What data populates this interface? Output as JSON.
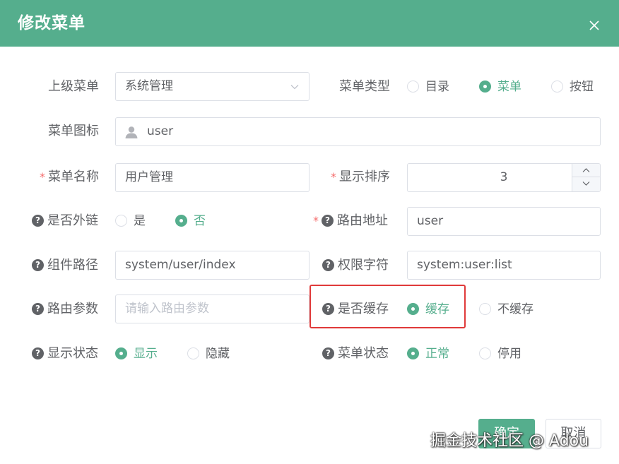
{
  "dialog": {
    "title": "修改菜单",
    "close_icon": "close-icon"
  },
  "form": {
    "parent_menu": {
      "label": "上级菜单",
      "value": "系统管理"
    },
    "menu_type": {
      "label": "菜单类型",
      "options": [
        "目录",
        "菜单",
        "按钮"
      ],
      "selected": "菜单"
    },
    "menu_icon": {
      "label": "菜单图标",
      "icon": "user-icon",
      "value": "user"
    },
    "menu_name": {
      "required_mark": "*",
      "label": "菜单名称",
      "value": "用户管理"
    },
    "order": {
      "required_mark": "*",
      "label": "显示排序",
      "value": "3"
    },
    "is_external": {
      "help": "?",
      "label": "是否外链",
      "options": [
        "是",
        "否"
      ],
      "selected": "否"
    },
    "route_path": {
      "required_mark": "*",
      "help": "?",
      "label": "路由地址",
      "value": "user"
    },
    "component": {
      "help": "?",
      "label": "组件路径",
      "value": "system/user/index"
    },
    "permission": {
      "help": "?",
      "label": "权限字符",
      "value": "system:user:list"
    },
    "route_params": {
      "help": "?",
      "label": "路由参数",
      "placeholder": "请输入路由参数"
    },
    "cache": {
      "help": "?",
      "label": "是否缓存",
      "options": [
        "缓存",
        "不缓存"
      ],
      "selected": "缓存"
    },
    "visible": {
      "help": "?",
      "label": "显示状态",
      "options": [
        "显示",
        "隐藏"
      ],
      "selected": "显示"
    },
    "status": {
      "help": "?",
      "label": "菜单状态",
      "options": [
        "正常",
        "停用"
      ],
      "selected": "正常"
    }
  },
  "footer": {
    "confirm_label": "确定",
    "cancel_label": "取消"
  },
  "watermark": "掘金技术社区 @ Adou",
  "colors": {
    "primary": "#55ae8d",
    "required": "#f56c6c",
    "highlight": "#e03a3a"
  }
}
